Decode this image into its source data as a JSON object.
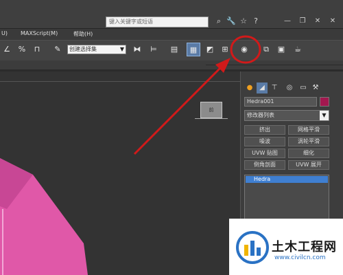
{
  "titlebar": {
    "search_placeholder": "键入关键字或短语",
    "icons": [
      "binoculars-icon",
      "wrench-icon",
      "star-icon",
      "help-icon"
    ],
    "window_controls": [
      "minimize",
      "restore",
      "close"
    ]
  },
  "menubar": {
    "items": [
      "U)",
      "MAXScript(M)",
      "帮助(H)"
    ]
  },
  "toolbar": {
    "selection_set_value": "创建选择集",
    "highlighted_tool": "material-editor-icon"
  },
  "viewport": {
    "viewcube_label": "前"
  },
  "command_panel": {
    "object_name": "Hedra001",
    "object_color": "#a3184f",
    "modifier_list_label": "修改器列表",
    "modifier_buttons": [
      "挤出",
      "网格平滑",
      "噪波",
      "涡轮平滑",
      "UVW 贴图",
      "细化",
      "倒角剖面",
      "UVW 展开"
    ],
    "stack_item": "Hedra"
  },
  "annotation": {
    "arrow_color": "#d11a1a",
    "circle_color": "#d11a1a"
  },
  "watermark": {
    "title": "土木工程网",
    "url": "www.civilcn.com"
  },
  "colors": {
    "accent_blue": "#3f7fd1",
    "object_pink": "#e058a8"
  }
}
